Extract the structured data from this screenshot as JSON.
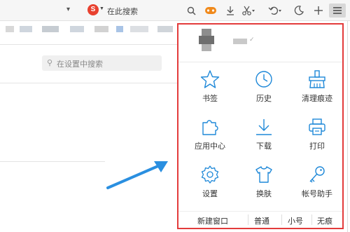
{
  "toolbar": {
    "search_engine_icon": "sogou-s-icon",
    "search_engine_glyph": "S",
    "search_placeholder": "在此搜索",
    "icons": [
      "search-icon",
      "game-icon",
      "download-icon",
      "scissors-icon",
      "undo-icon",
      "night-mode-icon",
      "menu-plus-icon"
    ]
  },
  "settings": {
    "search_placeholder": "在设置中搜索"
  },
  "menu": {
    "border_color": "#e33b3b",
    "icon_color": "#1e88d8",
    "items": [
      {
        "label": "书签",
        "icon": "star-icon"
      },
      {
        "label": "历史",
        "icon": "clock-icon"
      },
      {
        "label": "清理痕迹",
        "icon": "broom-icon"
      },
      {
        "label": "应用中心",
        "icon": "puzzle-icon"
      },
      {
        "label": "下载",
        "icon": "download-icon"
      },
      {
        "label": "打印",
        "icon": "printer-icon"
      },
      {
        "label": "设置",
        "icon": "gear-icon"
      },
      {
        "label": "换肤",
        "icon": "tshirt-icon"
      },
      {
        "label": "帐号助手",
        "icon": "key-icon"
      }
    ],
    "bottom": {
      "new_window": "新建窗口",
      "zoom_normal": "普通",
      "zoom_small": "小号",
      "zoom_none": "无痕"
    }
  },
  "annotation": {
    "arrow_color": "#2a8fe0"
  }
}
